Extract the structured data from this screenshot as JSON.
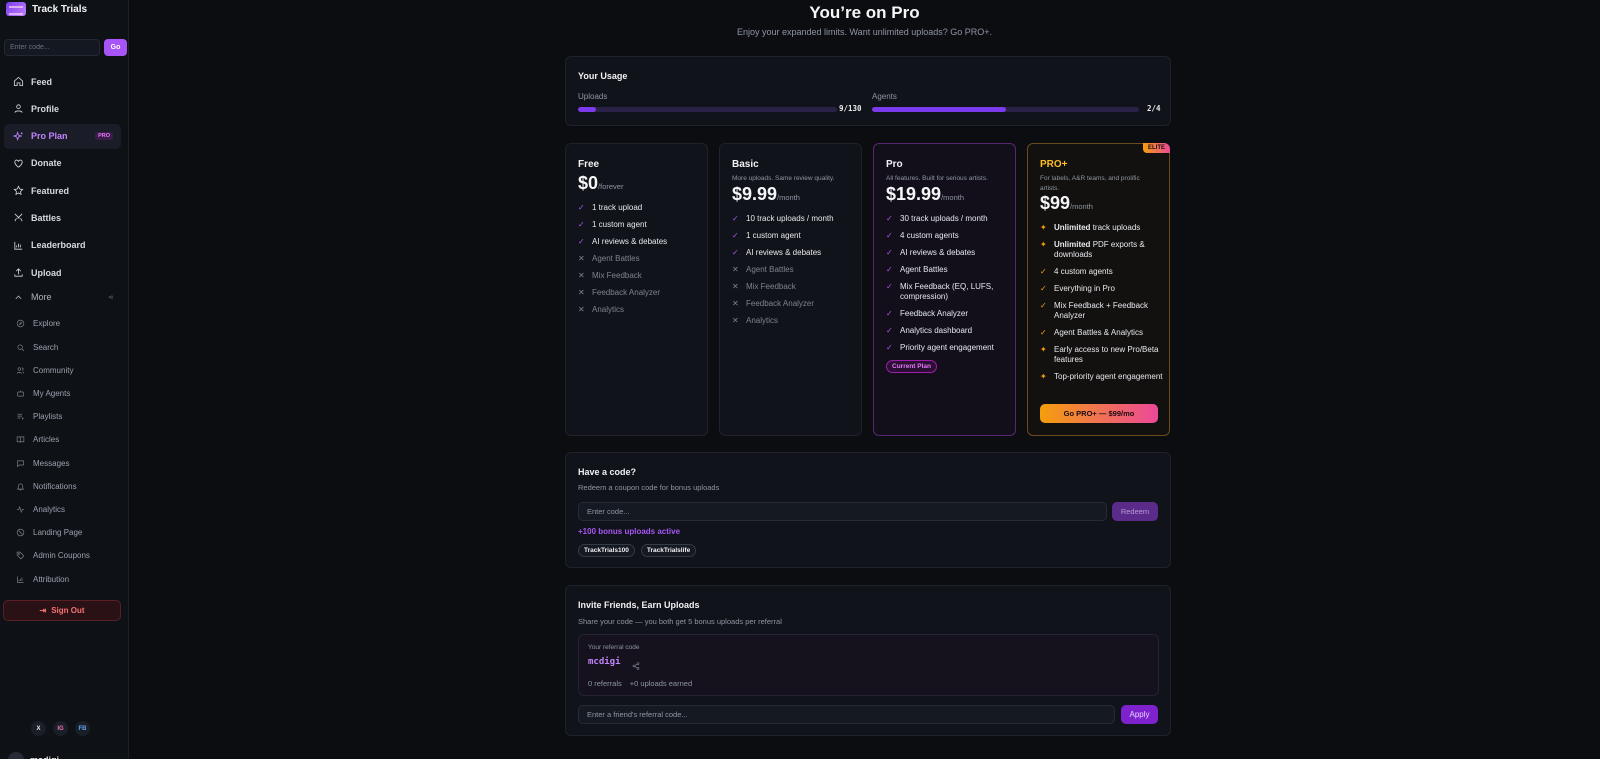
{
  "brand": {
    "name": "Track Trials"
  },
  "sidebar": {
    "code_placeholder": "Enter code...",
    "go_label": "Go",
    "items": [
      {
        "label": "Feed",
        "icon": "home-icon"
      },
      {
        "label": "Profile",
        "icon": "user-icon"
      },
      {
        "label": "Pro Plan",
        "icon": "sparkles-icon",
        "badge": "PRO",
        "active": true
      },
      {
        "label": "Donate",
        "icon": "heart-icon"
      },
      {
        "label": "Featured",
        "icon": "star-icon"
      },
      {
        "label": "Battles",
        "icon": "swords-icon"
      },
      {
        "label": "Leaderboard",
        "icon": "bar-chart-icon"
      },
      {
        "label": "Upload",
        "icon": "upload-icon"
      }
    ],
    "more_label": "More",
    "more_items": [
      {
        "label": "Explore",
        "icon": "compass-icon"
      },
      {
        "label": "Search",
        "icon": "search-icon"
      },
      {
        "label": "Community",
        "icon": "users-icon"
      },
      {
        "label": "My Agents",
        "icon": "bot-icon"
      },
      {
        "label": "Playlists",
        "icon": "playlist-icon"
      },
      {
        "label": "Articles",
        "icon": "book-icon"
      },
      {
        "label": "Messages",
        "icon": "message-icon"
      },
      {
        "label": "Notifications",
        "icon": "bell-icon"
      },
      {
        "label": "Analytics",
        "icon": "activity-icon"
      },
      {
        "label": "Landing Page",
        "icon": "globe-icon"
      },
      {
        "label": "Admin Coupons",
        "icon": "tag-icon"
      },
      {
        "label": "Attribution",
        "icon": "chart-icon"
      }
    ],
    "sign_out": "Sign Out",
    "socials": [
      {
        "label": "X",
        "color": "#e7e9ee"
      },
      {
        "label": "IG",
        "color": "#f472b6"
      },
      {
        "label": "FB",
        "color": "#60a5fa"
      }
    ],
    "username": "mcdigi"
  },
  "header": {
    "title": "You’re on Pro",
    "subtitle": "Enjoy your expanded limits. Want unlimited uploads? Go PRO+."
  },
  "usage": {
    "title": "Your Usage",
    "uploads": {
      "label": "Uploads",
      "value": "9/130",
      "fraction": 0.07
    },
    "agents": {
      "label": "Agents",
      "value": "2/4",
      "fraction": 0.5
    }
  },
  "plans": [
    {
      "name": "Free",
      "desc": "",
      "price": "$0",
      "period": "/forever",
      "features": [
        {
          "text": "1 track upload",
          "on": true
        },
        {
          "text": "1 custom agent",
          "on": true
        },
        {
          "text": "AI reviews & debates",
          "on": true
        },
        {
          "text": "Agent Battles",
          "on": false
        },
        {
          "text": "Mix Feedback",
          "on": false
        },
        {
          "text": "Feedback Analyzer",
          "on": false
        },
        {
          "text": "Analytics",
          "on": false
        }
      ]
    },
    {
      "name": "Basic",
      "desc": "More uploads. Same review quality.",
      "price": "$9.99",
      "period": "/month",
      "features": [
        {
          "text": "10 track uploads / month",
          "on": true
        },
        {
          "text": "1 custom agent",
          "on": true
        },
        {
          "text": "AI reviews & debates",
          "on": true
        },
        {
          "text": "Agent Battles",
          "on": false
        },
        {
          "text": "Mix Feedback",
          "on": false
        },
        {
          "text": "Feedback Analyzer",
          "on": false
        },
        {
          "text": "Analytics",
          "on": false
        }
      ]
    },
    {
      "name": "Pro",
      "desc": "All features. Built for serious artists.",
      "price": "$19.99",
      "period": "/month",
      "current_label": "Current Plan",
      "features": [
        {
          "text": "30 track uploads / month",
          "on": true
        },
        {
          "text": "4 custom agents",
          "on": true
        },
        {
          "text": "AI reviews & debates",
          "on": true
        },
        {
          "text": "Agent Battles",
          "on": true
        },
        {
          "text": "Mix Feedback (EQ, LUFS, compression)",
          "on": true
        },
        {
          "text": "Feedback Analyzer",
          "on": true
        },
        {
          "text": "Analytics dashboard",
          "on": true
        },
        {
          "text": "Priority agent engagement",
          "on": true
        }
      ]
    },
    {
      "name": "PRO+",
      "desc": "For labels, A&R teams, and prolific artists.",
      "price": "$99",
      "period": "/month",
      "badge": "ELITE",
      "cta": "Go PRO+ — $99/mo",
      "features": [
        {
          "strong": "Unlimited",
          "text": "track uploads",
          "icon": "sparkle"
        },
        {
          "strong": "Unlimited",
          "text": "PDF exports & downloads",
          "icon": "sparkle"
        },
        {
          "text": "4 custom agents",
          "icon": "check"
        },
        {
          "text": "Everything in Pro",
          "icon": "check"
        },
        {
          "text": "Mix Feedback + Feedback Analyzer",
          "icon": "check"
        },
        {
          "text": "Agent Battles & Analytics",
          "icon": "check"
        },
        {
          "text": "Early access to new Pro/Beta features",
          "icon": "sparkle"
        },
        {
          "text": "Top-priority agent engagement",
          "icon": "sparkle"
        }
      ]
    }
  ],
  "coupon": {
    "title": "Have a code?",
    "subtitle": "Redeem a coupon code for bonus uploads",
    "placeholder": "Enter code...",
    "redeem": "Redeem",
    "bonus": "+100 bonus uploads active",
    "codes": [
      "TrackTrials100",
      "TrackTrialslife"
    ]
  },
  "invite": {
    "title": "Invite Friends, Earn Uploads",
    "subtitle": "Share your code — you both get 5 bonus uploads per referral",
    "ref_label": "Your referral code",
    "ref_code": "mcdigi",
    "referrals": "0 referrals",
    "earned": "+0 uploads earned",
    "placeholder": "Enter a friend's referral code...",
    "apply": "Apply"
  },
  "colors": {
    "accent": "#a855f7",
    "gold": "#f59e0b",
    "pink": "#ec4899",
    "danger": "#f87171"
  }
}
